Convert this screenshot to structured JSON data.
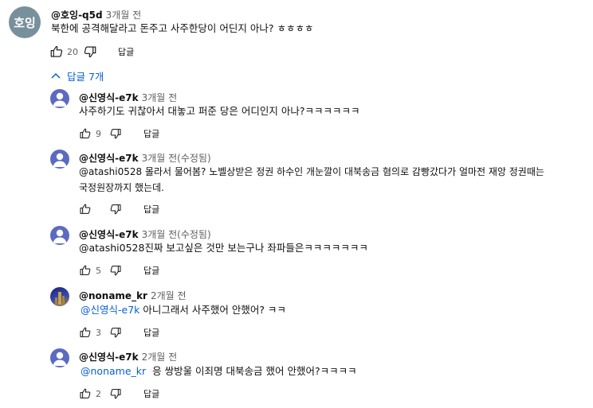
{
  "main_comment": {
    "avatar_text": "호잉",
    "author": "@호잉-q5d",
    "time": "3개월 전",
    "text": "북한에 공격해달라고 돈주고 사주한당이 어딘지 아나? ㅎㅎㅎㅎ",
    "likes": "20",
    "reply_label": "답글"
  },
  "replies_toggle": {
    "label": "답글 7개",
    "icon": "chevron-up-icon"
  },
  "replies": [
    {
      "author": "@신영식-e7k",
      "time": "3개월 전",
      "text": "사주하기도 귀찮아서 대놓고 퍼준 당은 어디인지 아나?ㅋㅋㅋㅋㅋㅋ",
      "likes": "9",
      "reply_label": "답글"
    },
    {
      "author": "@신영식-e7k",
      "time": "3개월 전(수정됨)",
      "text_line1": "@atashi0528 몰라서 물어봄? 노벨상받은 정권 하수인 개눈깔이 대북송금 혐의로 감빵갔다가 얼마전 재앙 정권때는",
      "text_line2": "국정원장까지 했는데.",
      "likes": "",
      "reply_label": "답글"
    },
    {
      "author": "@신영식-e7k",
      "time": "3개월 전(수정됨)",
      "text": "@atashi0528진짜 보고싶은 것만 보는구나 좌파들은ㅋㅋㅋㅋㅋㅋㅋ",
      "likes": "5",
      "reply_label": "답글"
    },
    {
      "author": "@noname_kr",
      "time": "2개월 전",
      "mention": "@신영식-e7k",
      "text": " 아니그래서 사주했어 안했어? ㅋㅋ",
      "likes": "3",
      "reply_label": "답글"
    },
    {
      "author": "@신영식-e7k",
      "time": "2개월 전",
      "mention": "@noname_kr",
      "text": "  응 쌍방울 이죄명 대북송금 했어 안했어?ㅋㅋㅋㅋ",
      "likes": "2",
      "reply_label": "답글"
    }
  ]
}
